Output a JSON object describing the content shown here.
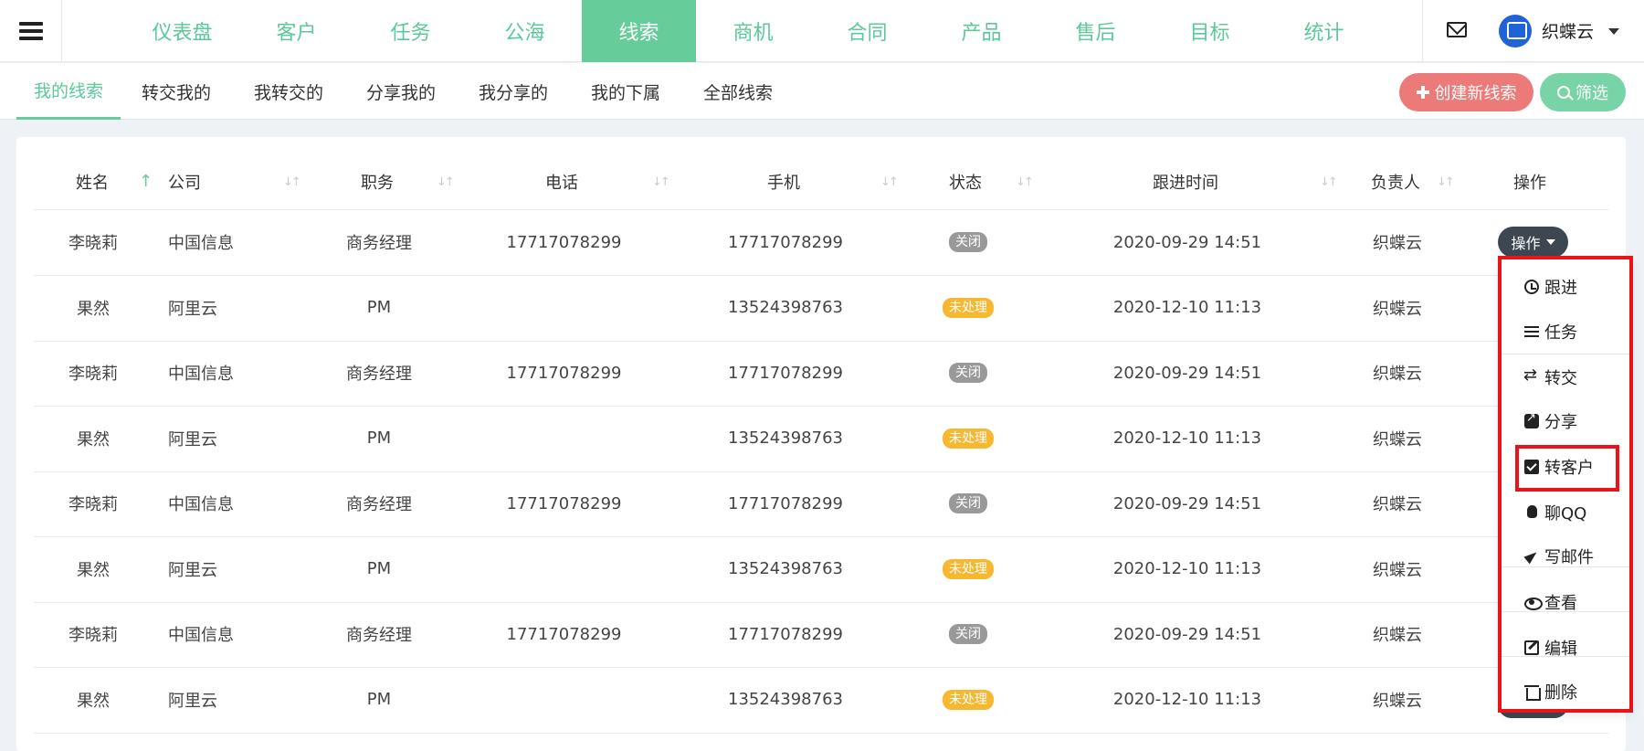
{
  "nav": {
    "items": [
      "仪表盘",
      "客户",
      "任务",
      "公海",
      "线索",
      "商机",
      "合同",
      "产品",
      "售后",
      "目标",
      "统计"
    ],
    "active_index": 4
  },
  "user": {
    "name": "织蝶云"
  },
  "tabs": {
    "items": [
      "我的线索",
      "转交我的",
      "我转交的",
      "分享我的",
      "我分享的",
      "我的下属",
      "全部线索"
    ],
    "active_index": 0
  },
  "actions": {
    "create_label": "创建新线索",
    "filter_label": "筛选"
  },
  "table": {
    "headers": [
      "姓名",
      "公司",
      "职务",
      "电话",
      "手机",
      "状态",
      "跟进时间",
      "负责人",
      "操作"
    ],
    "rows": [
      {
        "name": "李晓莉",
        "company": "中国信息",
        "title": "商务经理",
        "phone": "17717078299",
        "mobile": "17717078299",
        "status": "关闭",
        "time": "2020-09-29 14:51",
        "owner": "织蝶云"
      },
      {
        "name": "果然",
        "company": "阿里云",
        "title": "PM",
        "phone": "",
        "mobile": "13524398763",
        "status": "未处理",
        "time": "2020-12-10 11:13",
        "owner": "织蝶云"
      },
      {
        "name": "李晓莉",
        "company": "中国信息",
        "title": "商务经理",
        "phone": "17717078299",
        "mobile": "17717078299",
        "status": "关闭",
        "time": "2020-09-29 14:51",
        "owner": "织蝶云"
      },
      {
        "name": "果然",
        "company": "阿里云",
        "title": "PM",
        "phone": "",
        "mobile": "13524398763",
        "status": "未处理",
        "time": "2020-12-10 11:13",
        "owner": "织蝶云"
      },
      {
        "name": "李晓莉",
        "company": "中国信息",
        "title": "商务经理",
        "phone": "17717078299",
        "mobile": "17717078299",
        "status": "关闭",
        "time": "2020-09-29 14:51",
        "owner": "织蝶云"
      },
      {
        "name": "果然",
        "company": "阿里云",
        "title": "PM",
        "phone": "",
        "mobile": "13524398763",
        "status": "未处理",
        "time": "2020-12-10 11:13",
        "owner": "织蝶云"
      },
      {
        "name": "李晓莉",
        "company": "中国信息",
        "title": "商务经理",
        "phone": "17717078299",
        "mobile": "17717078299",
        "status": "关闭",
        "time": "2020-09-29 14:51",
        "owner": "织蝶云"
      },
      {
        "name": "果然",
        "company": "阿里云",
        "title": "PM",
        "phone": "",
        "mobile": "13524398763",
        "status": "未处理",
        "time": "2020-12-10 11:13",
        "owner": "织蝶云"
      }
    ]
  },
  "op_button": {
    "label": "操作"
  },
  "dropdown": {
    "items": [
      {
        "label": "跟进",
        "icon": "clock-icon"
      },
      {
        "label": "任务",
        "icon": "list-icon"
      },
      {
        "label": "转交",
        "icon": "swap-icon"
      },
      {
        "label": "分享",
        "icon": "share-icon"
      },
      {
        "label": "转客户",
        "icon": "check-square-icon"
      },
      {
        "label": "聊QQ",
        "icon": "qq-icon"
      },
      {
        "label": "写邮件",
        "icon": "send-icon"
      },
      {
        "label": "查看",
        "icon": "eye-icon"
      },
      {
        "label": "编辑",
        "icon": "edit-icon"
      },
      {
        "label": "删除",
        "icon": "trash-icon"
      }
    ]
  },
  "colors": {
    "brand_green": "#66cc99",
    "create_red": "#ec7a78",
    "highlight_red": "#e8141a",
    "badge_closed": "#999999",
    "badge_pending": "#f6b731"
  }
}
